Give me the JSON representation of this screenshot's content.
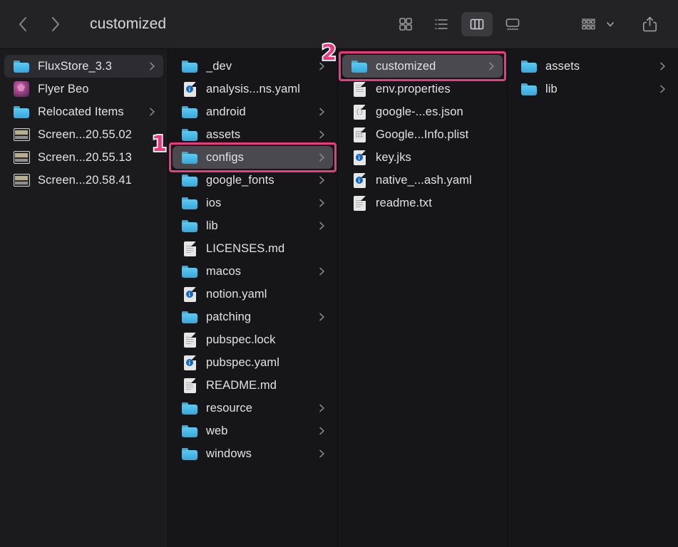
{
  "window": {
    "title": "customized",
    "background_color": "#161618",
    "accent_highlight_color": "#ec3a7e"
  },
  "toolbar": {
    "back_label": "Back",
    "forward_label": "Forward",
    "icons": {
      "back": "chevron-left-icon",
      "forward": "chevron-right-icon",
      "icon_view": "grid-view-icon",
      "list_view": "list-view-icon",
      "column_view": "column-view-icon",
      "gallery_view": "gallery-view-icon",
      "group_by": "group-by-icon",
      "group_chevron": "chevron-down-icon",
      "share": "share-icon"
    },
    "view_buttons": [
      {
        "name": "icon-view",
        "label": "Icon View",
        "active": false
      },
      {
        "name": "list-view",
        "label": "List View",
        "active": false
      },
      {
        "name": "column-view",
        "label": "Column View",
        "active": true
      },
      {
        "name": "gallery-view",
        "label": "Gallery View",
        "active": false
      }
    ],
    "group_label": "Group",
    "share_label": "Share"
  },
  "sidebar": {
    "items": [
      {
        "label": "FluxStore_3.3",
        "icon": "folder-icon",
        "chevron": true,
        "selected": true
      },
      {
        "label": "Flyer Beo",
        "icon": "app-icon",
        "chevron": false,
        "selected": false
      },
      {
        "label": "Relocated Items",
        "icon": "folder-icon",
        "chevron": true,
        "selected": false
      },
      {
        "label": "Screen...20.55.02",
        "icon": "screenshot-icon",
        "chevron": false,
        "selected": false
      },
      {
        "label": "Screen...20.55.13",
        "icon": "screenshot-icon",
        "chevron": false,
        "selected": false
      },
      {
        "label": "Screen...20.58.41",
        "icon": "screenshot-icon",
        "chevron": false,
        "selected": false
      }
    ]
  },
  "columns": [
    {
      "name": "column-fluxstore",
      "items": [
        {
          "label": "_dev",
          "icon": "folder-icon",
          "chevron": true,
          "selected": false
        },
        {
          "label": "analysis...ns.yaml",
          "icon": "yaml-file-icon",
          "chevron": false,
          "selected": false
        },
        {
          "label": "android",
          "icon": "folder-icon",
          "chevron": true,
          "selected": false
        },
        {
          "label": "assets",
          "icon": "folder-icon",
          "chevron": true,
          "selected": false
        },
        {
          "label": "configs",
          "icon": "folder-icon",
          "chevron": true,
          "selected": true
        },
        {
          "label": "google_fonts",
          "icon": "folder-icon",
          "chevron": true,
          "selected": false
        },
        {
          "label": "ios",
          "icon": "folder-icon",
          "chevron": true,
          "selected": false
        },
        {
          "label": "lib",
          "icon": "folder-icon",
          "chevron": true,
          "selected": false
        },
        {
          "label": "LICENSES.md",
          "icon": "text-file-icon",
          "chevron": false,
          "selected": false
        },
        {
          "label": "macos",
          "icon": "folder-icon",
          "chevron": true,
          "selected": false
        },
        {
          "label": "notion.yaml",
          "icon": "yaml-file-icon",
          "chevron": false,
          "selected": false
        },
        {
          "label": "patching",
          "icon": "folder-icon",
          "chevron": true,
          "selected": false
        },
        {
          "label": "pubspec.lock",
          "icon": "text-file-icon",
          "chevron": false,
          "selected": false
        },
        {
          "label": "pubspec.yaml",
          "icon": "yaml-file-icon",
          "chevron": false,
          "selected": false
        },
        {
          "label": "README.md",
          "icon": "text-file-icon",
          "chevron": false,
          "selected": false
        },
        {
          "label": "resource",
          "icon": "folder-icon",
          "chevron": true,
          "selected": false
        },
        {
          "label": "web",
          "icon": "folder-icon",
          "chevron": true,
          "selected": false
        },
        {
          "label": "windows",
          "icon": "folder-icon",
          "chevron": true,
          "selected": false
        }
      ]
    },
    {
      "name": "column-configs",
      "items": [
        {
          "label": "customized",
          "icon": "folder-icon",
          "chevron": true,
          "selected": true
        },
        {
          "label": "env.properties",
          "icon": "props-file-icon",
          "chevron": false,
          "selected": false
        },
        {
          "label": "google-...es.json",
          "icon": "json-file-icon",
          "chevron": false,
          "selected": false
        },
        {
          "label": "Google...Info.plist",
          "icon": "plist-file-icon",
          "chevron": false,
          "selected": false
        },
        {
          "label": "key.jks",
          "icon": "yaml-file-icon",
          "chevron": false,
          "selected": false
        },
        {
          "label": "native_...ash.yaml",
          "icon": "yaml-file-icon",
          "chevron": false,
          "selected": false
        },
        {
          "label": "readme.txt",
          "icon": "text-file-icon",
          "chevron": false,
          "selected": false
        }
      ]
    },
    {
      "name": "column-customized",
      "items": [
        {
          "label": "assets",
          "icon": "folder-icon",
          "chevron": true,
          "selected": false
        },
        {
          "label": "lib",
          "icon": "folder-icon",
          "chevron": true,
          "selected": false
        }
      ]
    }
  ],
  "annotations": [
    {
      "badge": "1",
      "target": "configs-row",
      "color": "#ec3a7e"
    },
    {
      "badge": "2",
      "target": "customized-row",
      "color": "#ec3a7e"
    }
  ]
}
